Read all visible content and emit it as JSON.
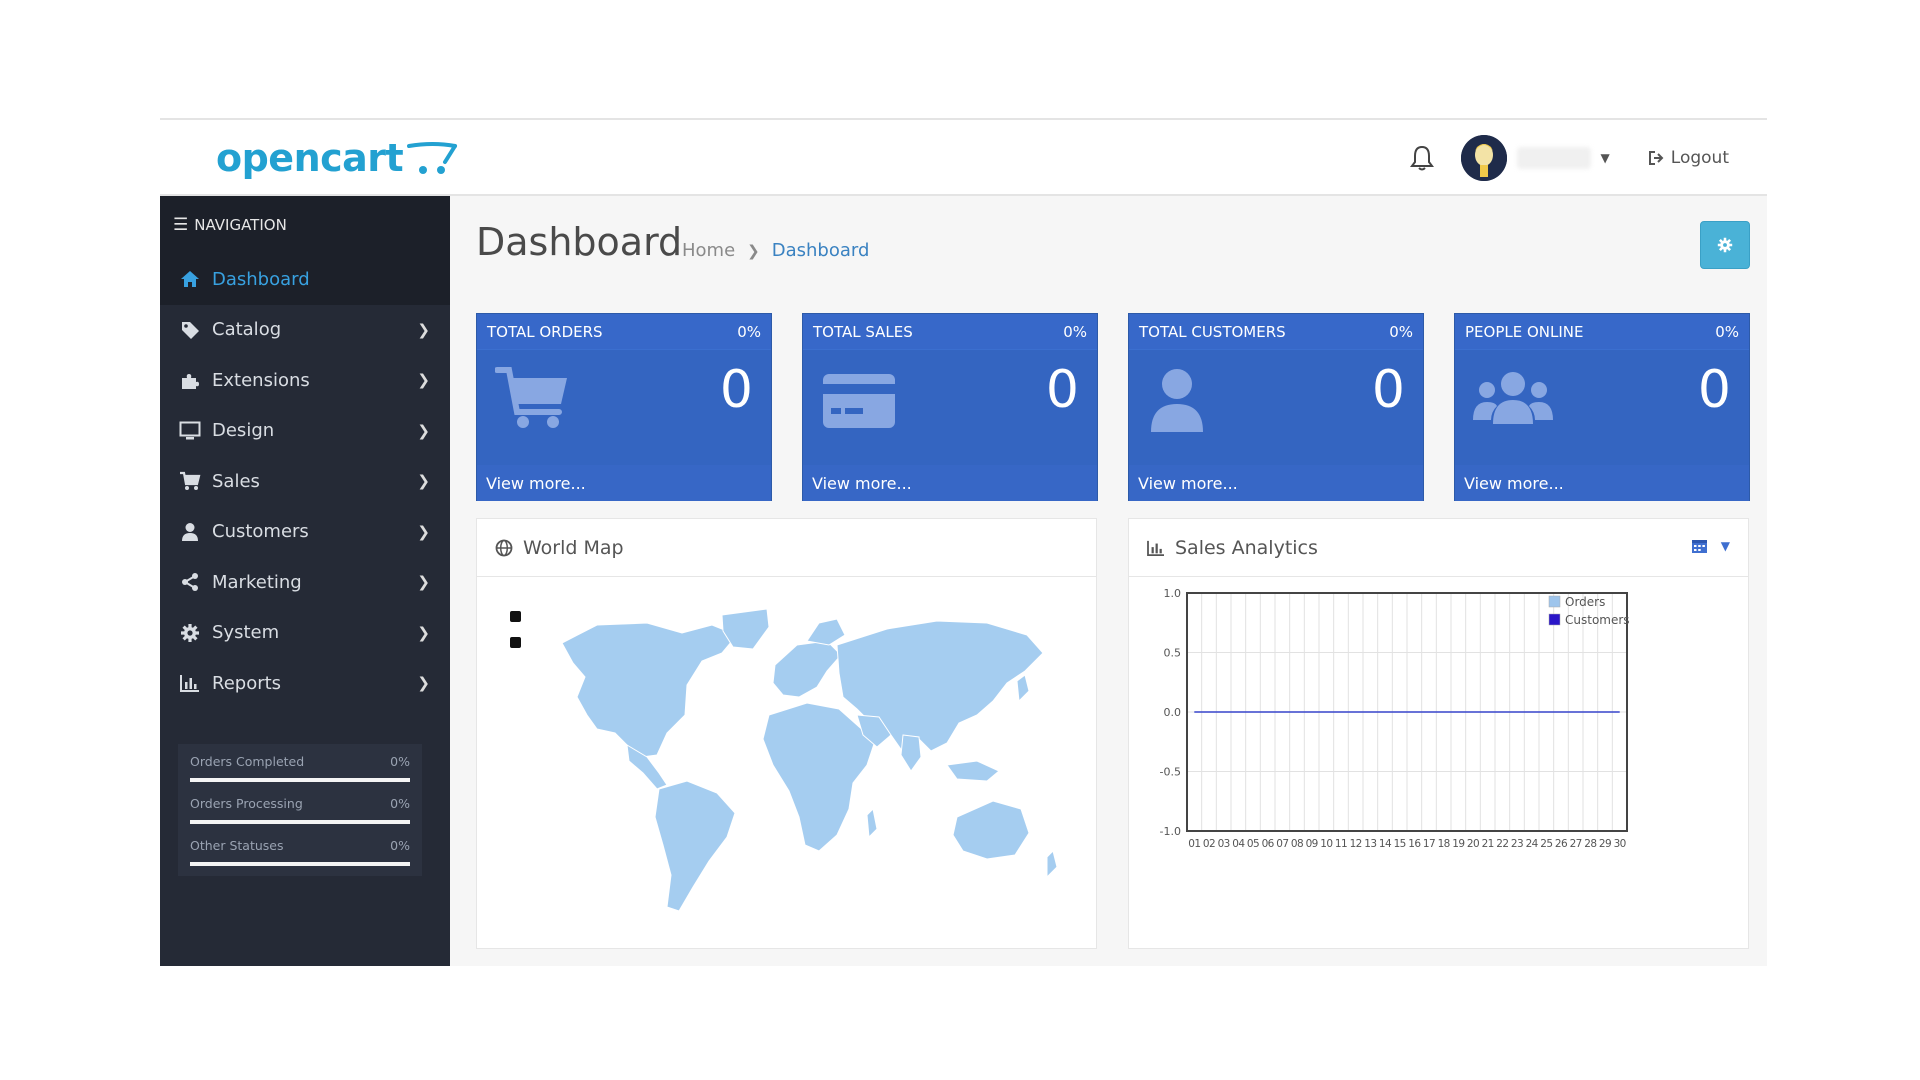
{
  "header": {
    "logo_text": "opencart",
    "logout_label": "Logout",
    "logout_icon": "sign-out-icon",
    "bell_icon": "bell-icon"
  },
  "sidebar": {
    "title": "NAVIGATION",
    "items": [
      {
        "label": "Dashboard",
        "icon": "home-icon",
        "active": true
      },
      {
        "label": "Catalog",
        "icon": "tag-icon"
      },
      {
        "label": "Extensions",
        "icon": "puzzle-icon"
      },
      {
        "label": "Design",
        "icon": "monitor-icon"
      },
      {
        "label": "Sales",
        "icon": "cart-icon"
      },
      {
        "label": "Customers",
        "icon": "user-icon"
      },
      {
        "label": "Marketing",
        "icon": "share-icon"
      },
      {
        "label": "System",
        "icon": "gear-icon"
      },
      {
        "label": "Reports",
        "icon": "bar-chart-icon"
      }
    ],
    "statuses": [
      {
        "label": "Orders Completed",
        "percent": "0%",
        "fill": 1.0
      },
      {
        "label": "Orders Processing",
        "percent": "0%",
        "fill": 1.0
      },
      {
        "label": "Other Statuses",
        "percent": "0%",
        "fill": 1.0
      }
    ]
  },
  "page": {
    "title": "Dashboard",
    "breadcrumb": [
      "Home",
      "Dashboard"
    ]
  },
  "tiles": [
    {
      "title": "TOTAL ORDERS",
      "percent": "0%",
      "value": "0",
      "link": "View more...",
      "icon": "cart-icon"
    },
    {
      "title": "TOTAL SALES",
      "percent": "0%",
      "value": "0",
      "link": "View more...",
      "icon": "credit-card-icon"
    },
    {
      "title": "TOTAL CUSTOMERS",
      "percent": "0%",
      "value": "0",
      "link": "View more...",
      "icon": "user-icon"
    },
    {
      "title": "PEOPLE ONLINE",
      "percent": "0%",
      "value": "0",
      "link": "View more...",
      "icon": "users-icon"
    }
  ],
  "map_panel": {
    "title": "World Map",
    "icon": "globe-icon"
  },
  "chart_panel": {
    "title": "Sales Analytics",
    "icon": "bar-chart-icon",
    "range_icon": "calendar-icon"
  },
  "colors": {
    "accent": "#3869c8",
    "sidebar": "#252a36",
    "link": "#38a1e0",
    "map_land": "#a5cdf0"
  },
  "chart_data": {
    "type": "line",
    "x": [
      "01",
      "02",
      "03",
      "04",
      "05",
      "06",
      "07",
      "08",
      "09",
      "10",
      "11",
      "12",
      "13",
      "14",
      "15",
      "16",
      "17",
      "18",
      "19",
      "20",
      "21",
      "22",
      "23",
      "24",
      "25",
      "26",
      "27",
      "28",
      "29",
      "30"
    ],
    "series": [
      {
        "name": "Orders",
        "color": "#9ec5ec",
        "values": [
          0,
          0,
          0,
          0,
          0,
          0,
          0,
          0,
          0,
          0,
          0,
          0,
          0,
          0,
          0,
          0,
          0,
          0,
          0,
          0,
          0,
          0,
          0,
          0,
          0,
          0,
          0,
          0,
          0,
          0
        ]
      },
      {
        "name": "Customers",
        "color": "#2a16c8",
        "values": [
          0,
          0,
          0,
          0,
          0,
          0,
          0,
          0,
          0,
          0,
          0,
          0,
          0,
          0,
          0,
          0,
          0,
          0,
          0,
          0,
          0,
          0,
          0,
          0,
          0,
          0,
          0,
          0,
          0,
          0
        ]
      }
    ],
    "yticks": [
      "1.0",
      "0.5",
      "0.0",
      "-0.5",
      "-1.0"
    ],
    "ylim": [
      -1.0,
      1.0
    ],
    "grid": true,
    "legend": "top-right"
  }
}
